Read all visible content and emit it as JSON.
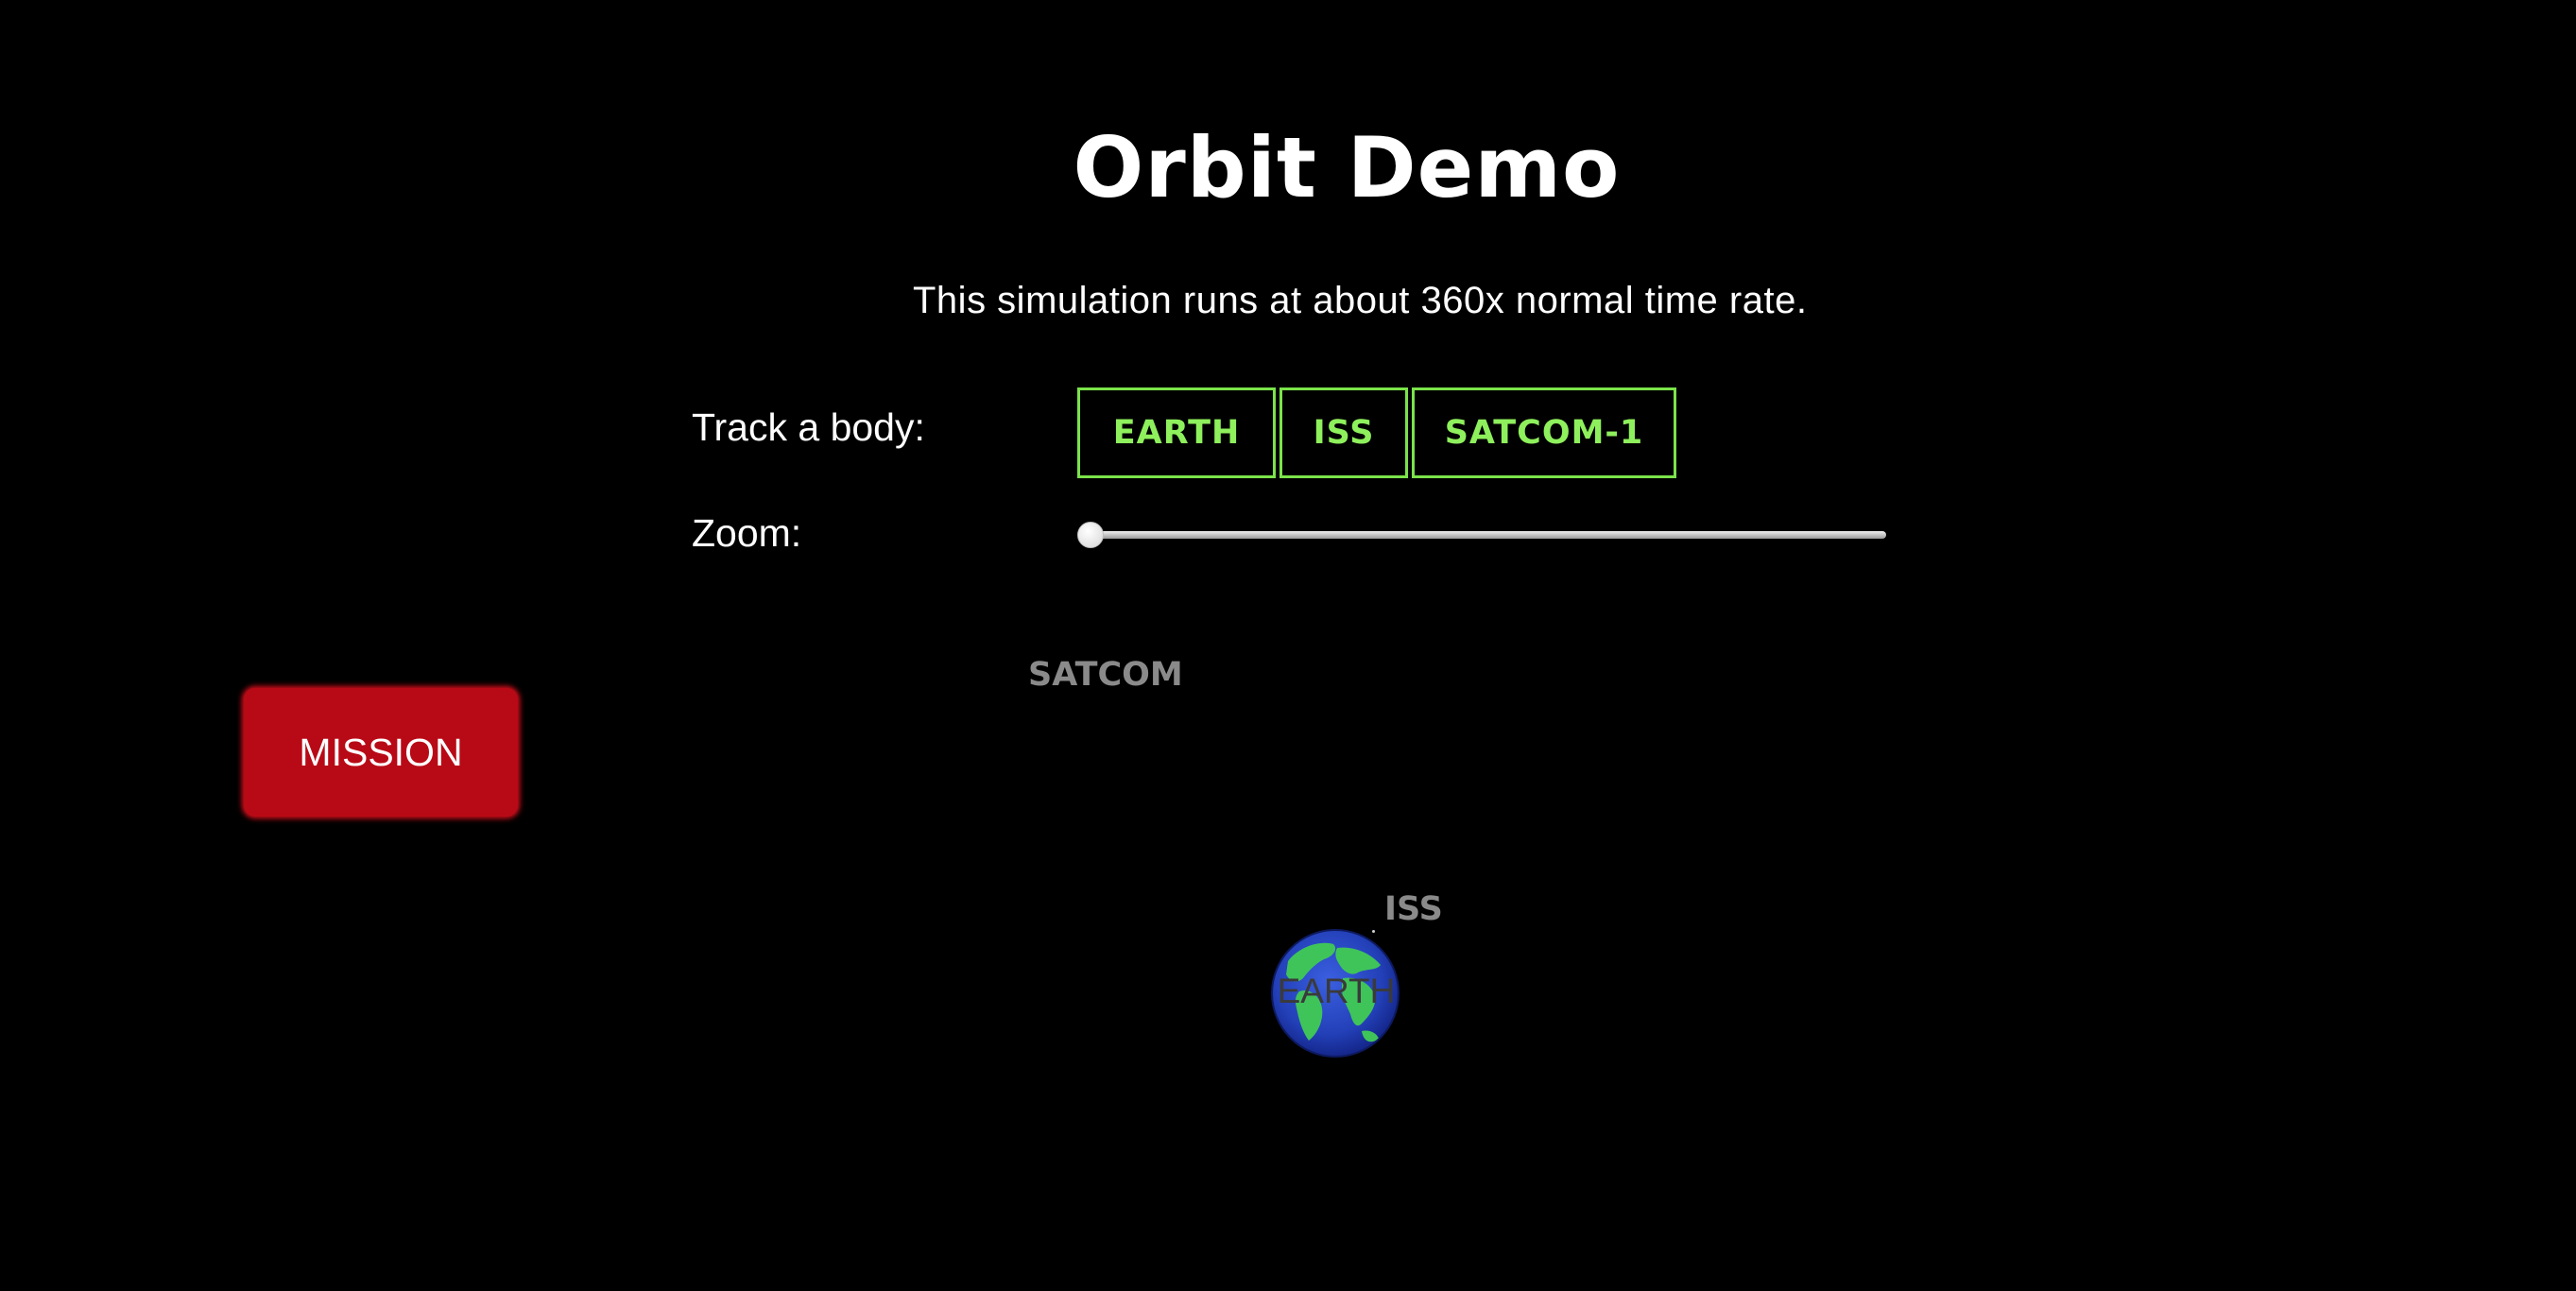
{
  "page": {
    "title": "Orbit Demo",
    "subtitle": "This simulation runs at about 360x normal time rate."
  },
  "controls": {
    "track_label": "Track a body:",
    "track_buttons": [
      "EARTH",
      "ISS",
      "SATCOM-1"
    ],
    "zoom_label": "Zoom:",
    "zoom_level": 0
  },
  "mission_button": {
    "label": "MISSION"
  },
  "scene": {
    "bodies": [
      {
        "label": "SATCOM"
      },
      {
        "label": "ISS"
      },
      {
        "label": "EARTH"
      }
    ]
  },
  "colors": {
    "background": "#000000",
    "track_button_accent": "#8ef05c",
    "mission_button": "#b80a16",
    "earth_ocean": "#2340b8",
    "earth_land": "#3fc45a"
  },
  "icons": {
    "earth": "earth-globe-icon",
    "zoom_thumb": "slider-thumb"
  }
}
